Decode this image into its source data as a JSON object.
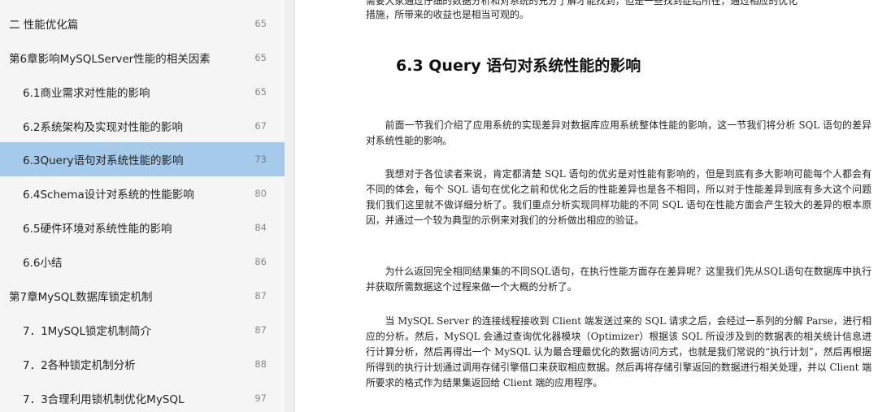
{
  "toc": {
    "items": [
      {
        "label": "二 性能优化篇",
        "page": "65",
        "level": 1,
        "active": false
      },
      {
        "label": "第6章影响MySQLServer性能的相关因素",
        "page": "65",
        "level": 1,
        "active": false
      },
      {
        "label": "6.1商业需求对性能的影响",
        "page": "65",
        "level": 2,
        "active": false
      },
      {
        "label": "6.2系统架构及实现对性能的影响",
        "page": "67",
        "level": 2,
        "active": false
      },
      {
        "label": "6.3Query语句对系统性能的影响",
        "page": "73",
        "level": 2,
        "active": true
      },
      {
        "label": "6.4Schema设计对系统的性能影响",
        "page": "80",
        "level": 2,
        "active": false
      },
      {
        "label": "6.5硬件环境对系统性能的影响",
        "page": "84",
        "level": 2,
        "active": false
      },
      {
        "label": "6.6小结",
        "page": "86",
        "level": 2,
        "active": false
      },
      {
        "label": "第7章MySQL数据库锁定机制",
        "page": "87",
        "level": 1,
        "active": false
      },
      {
        "label": "7．1MySQL锁定机制简介",
        "page": "87",
        "level": 2,
        "active": false
      },
      {
        "label": "7．2各种锁定机制分析",
        "page": "88",
        "level": 2,
        "active": false
      },
      {
        "label": "7．3合理利用锁机制优化MySQL",
        "page": "97",
        "level": 2,
        "active": false
      }
    ]
  },
  "content": {
    "top_fragment_1": "需要大家通过仔细的数据分析和对系统的充分了解才能找到，但是一些找到症结所在，通过相应的优化",
    "top_fragment_2": "措施，所带来的收益也是相当可观的。",
    "heading": "6.3 Query 语句对系统性能的影响",
    "paragraphs": [
      "前面一节我们介绍了应用系统的实现差异对数据库应用系统整体性能的影响，这一节我们将分析 SQL 语句的差异对系统性能的影响。",
      "我想对于各位读者来说，肯定都清楚 SQL 语句的优劣是对性能有影响的，但是到底有多大影响可能每个人都会有不同的体会，每个 SQL 语句在优化之前和优化之后的性能差异也是各不相同，所以对于性能差异到底有多大这个问题我们我们这里就不做详细分析了。我们重点分析实现同样功能的不同 SQL 语句在性能方面会产生较大的差异的根本原因，并通过一个较为典型的示例来对我们的分析做出相应的验证。",
      "为什么返回完全相同结果集的不同SQL语句，在执行性能方面存在差异呢？这里我们先从SQL语句在数据库中执行并获取所需数据这个过程来做一个大概的分析了。",
      "当 MySQL Server 的连接线程接收到 Client 端发送过来的 SQL 请求之后，会经过一系列的分解 Parse，进行相应的分析。然后，MySQL 会通过查询优化器模块（Optimizer）根据该 SQL 所设涉及到的数据表的相关统计信息进行计算分析，然后再得出一个 MySQL 认为最合理最优化的数据访问方式，也就是我们常说的“执行计划”，然后再根据所得到的执行计划通过调用存储引擎借口来获取相应数据。然后再将存储引擎返回的数据进行相关处理，并以 Client 端所要求的格式作为结果集返回给 Client 端的应用程序。"
    ]
  },
  "colors": {
    "sidebar_bg": "#f5f5f5",
    "active_bg": "#a6cbea",
    "text": "#222222",
    "page_number": "#8a8a8a"
  }
}
